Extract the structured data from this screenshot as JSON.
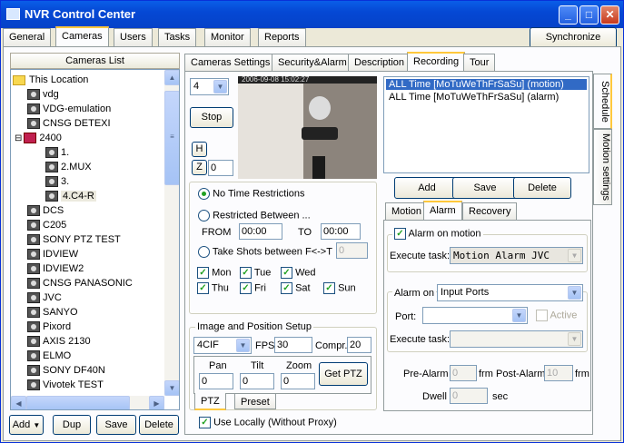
{
  "window": {
    "title": "NVR Control Center"
  },
  "main_tabs": [
    "General",
    "Cameras",
    "Users",
    "Tasks",
    "Monitor",
    "Reports"
  ],
  "synchronize_label": "Synchronize",
  "cameras_list": {
    "header": "Cameras List",
    "items": [
      "This Location",
      "vdg",
      "VDG-emulation",
      "CNSG DETEXI",
      "2400",
      "1.",
      "2.MUX",
      "3.",
      "4.C4-R",
      "DCS",
      "C205",
      "SONY PTZ TEST",
      "IDVIEW",
      "IDVIEW2",
      "CNSG PANASONIC",
      "JVC",
      "SANYO",
      "Pixord",
      "AXIS 2130",
      "ELMO",
      "SONY DF40N",
      "Vivotek TEST"
    ],
    "collapse_symbol": "⊟"
  },
  "bottom_buttons": {
    "add": "Add",
    "dup": "Dup",
    "save": "Save",
    "delete": "Delete"
  },
  "cam_tabs": [
    "Cameras Settings",
    "Security&Alarm",
    "Description",
    "Recording",
    "Tour"
  ],
  "recording": {
    "channel": "4",
    "stop": "Stop",
    "h": "H",
    "z": "Z",
    "z_value": "0",
    "video_timestamp": "2006-09-08 15:02:27",
    "no_time": "No Time Restrictions",
    "restricted": "Restricted Between ...",
    "from_label": "FROM",
    "from_value": "00:00",
    "to_label": "TO",
    "to_value": "00:00",
    "take_shots": "Take Shots between F<->T",
    "shots_value": "0",
    "days": {
      "mon": "Mon",
      "tue": "Tue",
      "wed": "Wed",
      "thu": "Thu",
      "fri": "Fri",
      "sat": "Sat",
      "sun": "Sun"
    },
    "image_group": "Image and Position Setup",
    "resolution": "4CIF",
    "fps_label": "FPS",
    "fps_value": "30",
    "compr_label": "Compr.",
    "compr_value": "20",
    "pan_label": "Pan",
    "tilt_label": "Tilt",
    "zoom_label": "Zoom",
    "pan_value": "0",
    "tilt_value": "0",
    "zoom_value": "0",
    "get_ptz": "Get PTZ",
    "ptz_tab": "PTZ",
    "preset_tab": "Preset",
    "use_locally": "Use Locally (Without Proxy)"
  },
  "schedule": {
    "items": [
      "ALL Time [MoTuWeThFrSaSu] (motion)",
      "ALL Time [MoTuWeThFrSaSu] (alarm)"
    ],
    "add": "Add",
    "save": "Save",
    "delete": "Delete",
    "subtabs": [
      "Motion",
      "Alarm",
      "Recovery"
    ],
    "alarm_on_motion": "Alarm on motion",
    "execute_task_label": "Execute task:",
    "execute_task_value": "Motion Alarm JVC",
    "alarm_on_label": "Alarm on",
    "alarm_on_value": "Input Ports",
    "port_label": "Port:",
    "active_label": "Active",
    "execute_task2_label": "Execute task:",
    "pre_alarm_label": "Pre-Alarm",
    "pre_alarm_value": "0",
    "frm1": "frm",
    "post_alarm_label": "Post-Alarm",
    "post_alarm_value": "10",
    "frm2": "frm",
    "dwell_label": "Dwell",
    "dwell_value": "0",
    "sec_label": "sec"
  },
  "side_tabs": [
    "Schedule",
    "Motion settings"
  ]
}
